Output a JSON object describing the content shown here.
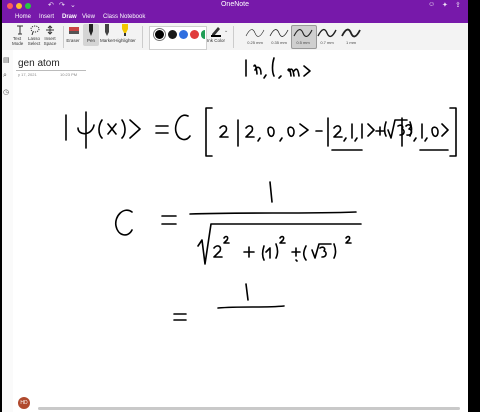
{
  "app": {
    "title": "OneNote"
  },
  "menubar": {
    "items": [
      "Home",
      "Insert",
      "Draw",
      "View",
      "Class Notebook"
    ],
    "active": "Draw"
  },
  "ribbon": {
    "tools": [
      {
        "label": "Text Mode",
        "icon": "text-cursor-icon"
      },
      {
        "label": "Lasso Select",
        "icon": "lasso-icon"
      },
      {
        "label": "Insert Space",
        "icon": "insert-space-icon"
      },
      {
        "label": "Eraser",
        "icon": "eraser-icon"
      },
      {
        "label": "Pen",
        "icon": "pen-icon"
      },
      {
        "label": "Marker",
        "icon": "marker-icon"
      },
      {
        "label": "Highlighter",
        "icon": "highlighter-icon"
      }
    ],
    "colors": [
      "#000000",
      "#1a1a1a",
      "#2f6fe0",
      "#e03c3c",
      "#1f9d55"
    ],
    "ink_color_label": "Ink Color",
    "pens": [
      "0.25 mm",
      "0.35 mm",
      "0.5 mm",
      "0.7 mm",
      "1 mm"
    ],
    "selected_pen": "0.5 mm"
  },
  "page": {
    "title": "gen atom",
    "date": "y 17, 2021",
    "time": "10:23 PM"
  },
  "user": {
    "initials": "HD"
  }
}
